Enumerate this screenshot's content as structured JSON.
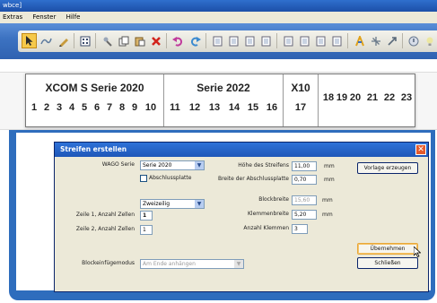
{
  "window": {
    "title": "wbce]"
  },
  "menu": {
    "items": [
      "Extras",
      "Fenster",
      "Hilfe"
    ]
  },
  "toolbar": {
    "buttons": [
      "pointer-icon",
      "wire-icon",
      "pen-icon",
      "grid-icon",
      "stamp-icon",
      "copy-icon",
      "paste-icon",
      "delete-icon",
      "undo-icon",
      "redo-icon",
      "page1-icon",
      "page2-icon",
      "page3-icon",
      "page4-icon",
      "page5-icon",
      "page6-icon",
      "page7-icon",
      "page8-icon",
      "mark-icon",
      "star-icon",
      "tool-icon",
      "help-icon",
      "bulb-icon"
    ]
  },
  "strip": {
    "groups": [
      {
        "title": "XCOM S Serie 2020",
        "cells": [
          "1",
          "2",
          "3",
          "4",
          "5",
          "6",
          "7",
          "8",
          "9",
          "10"
        ]
      },
      {
        "title": "Serie 2022",
        "cells": [
          "11",
          "12",
          "13",
          "14",
          "15",
          "16"
        ]
      },
      {
        "title": "X10",
        "cells": [
          "17"
        ]
      }
    ],
    "singles": [
      "18",
      "19",
      "20",
      "21",
      "22",
      "23"
    ]
  },
  "dialog": {
    "title": "Streifen erstellen",
    "wago_serie_label": "WAGO Serie",
    "wago_serie_value": "Serie 2020",
    "abschlussplatte_label": "Abschlussplatte",
    "zweizeilig_value": "Zweizeilig",
    "zeile1_label": "Zeile 1, Anzahl Zellen",
    "zeile1_value": "1",
    "zeile2_label": "Zeile 2, Anzahl Zellen",
    "zeile2_value": "1",
    "blockeinfuege_label": "Blockeinfügemodus",
    "blockeinfuege_value": "Am Ende anhängen",
    "hoehe_label": "Höhe des Streifens",
    "hoehe_value": "11,00",
    "hoehe_unit": "mm",
    "breite_abschluss_label": "Breite der Abschlussplatte",
    "breite_abschluss_value": "0,70",
    "breite_abschluss_unit": "mm",
    "blockbreite_label": "Blockbreite",
    "blockbreite_value": "15,60",
    "blockbreite_unit": "mm",
    "klemmenbreite_label": "Klemmenbreite",
    "klemmenbreite_value": "5,20",
    "klemmenbreite_unit": "mm",
    "anzahl_klemmen_label": "Anzahl Klemmen",
    "anzahl_klemmen_value": "3",
    "vorlage_button": "Vorlage erzeugen",
    "uebernehmen_button": "Übernehmen",
    "schliessen_button": "Schließen",
    "close_glyph": "✕"
  }
}
